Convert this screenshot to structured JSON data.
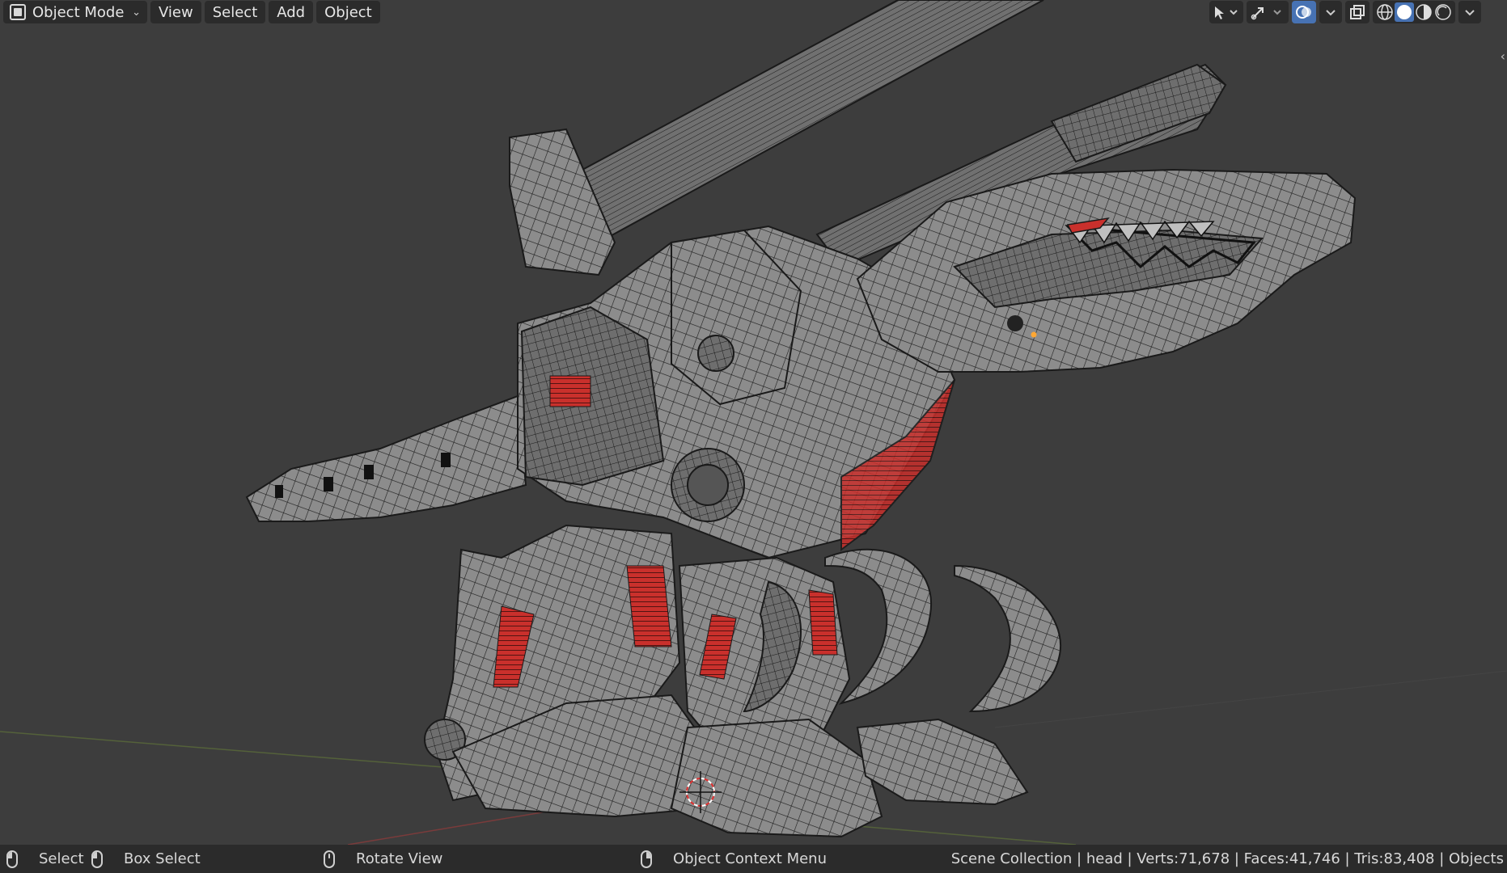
{
  "header": {
    "mode_label": "Object Mode",
    "menu": [
      "View",
      "Select",
      "Add",
      "Object"
    ],
    "tool_icons": [
      "select-cursor-icon",
      "transform-gizmo-icon",
      "overlays-icon",
      "xray-icon",
      "wireframe-shading-icon",
      "solid-shading-icon",
      "material-shading-icon",
      "rendered-shading-icon"
    ],
    "active_shading": "solid",
    "accent_color": "#4772b3"
  },
  "viewport": {
    "background_color": "#3d3d3d",
    "model_fill": "#8a8a8a",
    "wire_color": "#1c1c1c",
    "highlight_red": "#c9302c"
  },
  "statusbar": {
    "items": [
      {
        "icon": "mouse-left-icon",
        "label": "Select"
      },
      {
        "icon": "mouse-box-select-icon",
        "label": "Box Select"
      },
      {
        "icon": "mouse-middle-icon",
        "label": "Rotate View"
      },
      {
        "icon": "mouse-right-icon",
        "label": "Object Context Menu"
      }
    ],
    "scene_info": "Scene Collection | head | Verts:71,678 | Faces:41,746 | Tris:83,408 | Objects"
  }
}
